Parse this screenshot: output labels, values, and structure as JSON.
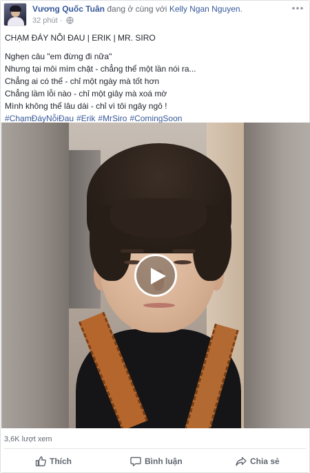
{
  "post": {
    "author": "Vương Quốc Tuân",
    "with_text": "đang ở cùng với",
    "tagged": "Kelly Ngan Nguyen",
    "tagged_suffix": ".",
    "time": "32 phút",
    "time_sep": "·",
    "privacy_icon": "globe-icon",
    "title": "CHẠM ĐÁY NỖI ĐAU | ERIK | MR. SIRO",
    "lines": [
      "Nghẹn câu \"em đừng đi nữa\"",
      "Nhưng tại môi mím chặt - chẳng thể một lần nói ra...",
      "Chẳng ai có thể - chỉ một ngày mà tốt hơn",
      "Chẳng lầm lỗi nào - chỉ một giây mà xoá mờ",
      "Mình không thể lâu dài - chỉ vì tôi ngây ngô !"
    ],
    "hashtags": [
      "#ChạmĐáyNỗiĐau",
      "#Erik",
      "#MrSiro",
      "#ComingSoon"
    ]
  },
  "video": {
    "play_icon": "play-icon",
    "colors": {
      "strap": "#b4662d",
      "shirt": "#151517"
    }
  },
  "stats": {
    "views": "3,6K lượt xem"
  },
  "actions": {
    "like": {
      "label": "Thích",
      "icon": "thumbs-up-icon"
    },
    "comment": {
      "label": "Bình luận",
      "icon": "comment-icon"
    },
    "share": {
      "label": "Chia sẻ",
      "icon": "share-icon"
    }
  },
  "colors": {
    "link": "#365899",
    "muted": "#90949c",
    "text": "#1d2129"
  }
}
